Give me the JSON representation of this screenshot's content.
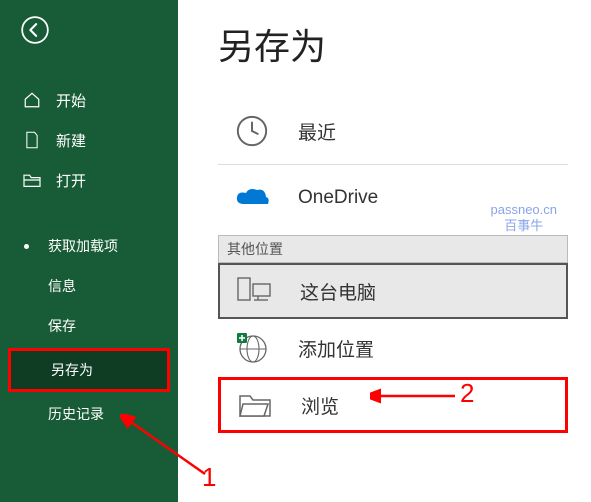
{
  "page_title": "另存为",
  "sidebar": {
    "items": [
      {
        "label": "开始"
      },
      {
        "label": "新建"
      },
      {
        "label": "打开"
      },
      {
        "label": "获取加载项"
      },
      {
        "label": "信息"
      },
      {
        "label": "保存"
      },
      {
        "label": "另存为"
      },
      {
        "label": "历史记录"
      }
    ]
  },
  "locations": {
    "recent": "最近",
    "onedrive": "OneDrive",
    "section_other": "其他位置",
    "this_pc": "这台电脑",
    "add_place": "添加位置",
    "browse": "浏览"
  },
  "watermark": {
    "line1": "passneo.cn",
    "line2": "百事牛"
  },
  "annotations": {
    "n1": "1",
    "n2": "2"
  }
}
